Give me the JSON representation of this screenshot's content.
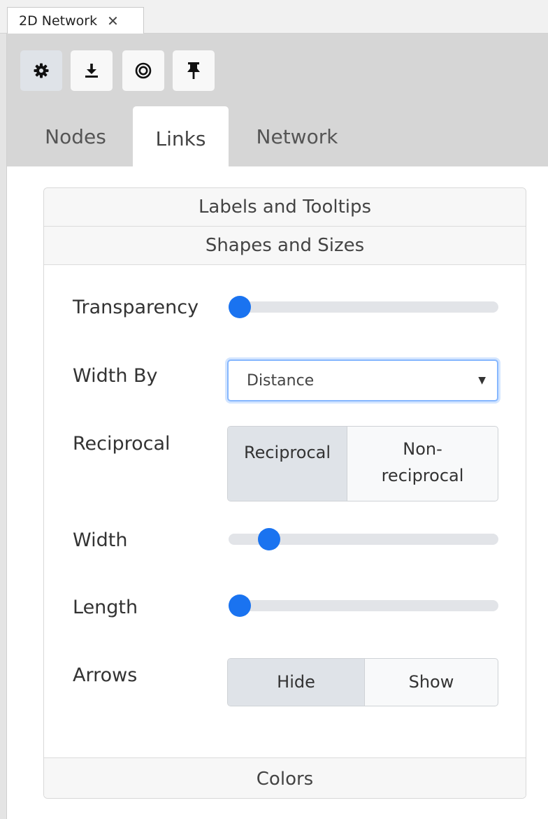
{
  "doc_tab": {
    "title": "2D Network",
    "close": "✕"
  },
  "toolbar": {
    "buttons": [
      {
        "icon": "gear-icon",
        "active": true
      },
      {
        "icon": "download-icon",
        "active": false
      },
      {
        "icon": "target-icon",
        "active": false
      },
      {
        "icon": "pin-icon",
        "active": false
      }
    ]
  },
  "tabs": [
    {
      "label": "Nodes",
      "active": false
    },
    {
      "label": "Links",
      "active": true
    },
    {
      "label": "Network",
      "active": false
    }
  ],
  "accordion": {
    "labels_tooltips": "Labels and Tooltips",
    "shapes_sizes": "Shapes and Sizes",
    "colors": "Colors"
  },
  "controls": {
    "transparency": {
      "label": "Transparency",
      "value": 0.0
    },
    "width_by": {
      "label": "Width By",
      "value": "Distance"
    },
    "reciprocal": {
      "label": "Reciprocal",
      "options": [
        "Reciprocal",
        "Non-reciprocal"
      ],
      "selected": "Reciprocal"
    },
    "width": {
      "label": "Width",
      "value": 0.12
    },
    "length": {
      "label": "Length",
      "value": 0.0
    },
    "arrows": {
      "label": "Arrows",
      "options": [
        "Hide",
        "Show"
      ],
      "selected": "Hide"
    }
  },
  "colors": {
    "accent": "#1a73f0",
    "header_bg": "#d6d6d6",
    "selected_btn": "#dfe3e8"
  }
}
